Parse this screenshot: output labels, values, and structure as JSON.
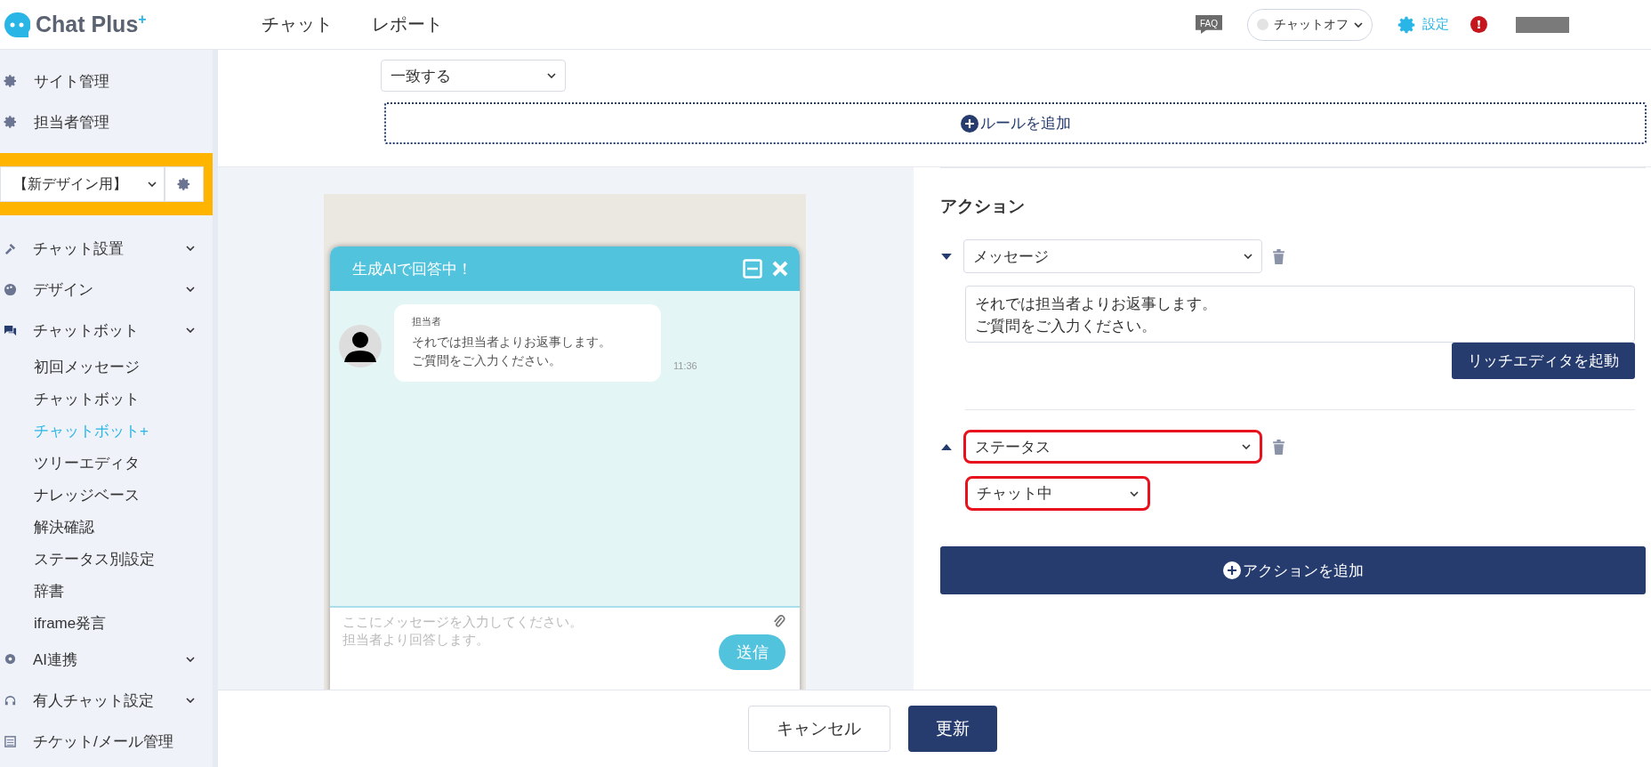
{
  "header": {
    "logo": "Chat Plus",
    "logo_mark": "+",
    "nav": [
      {
        "label": "チャット",
        "selected": false
      },
      {
        "label": "レポート",
        "selected": false
      }
    ],
    "faq_label": "FAQ",
    "chat_status": {
      "label": "チャットオフ",
      "on": false
    },
    "settings_label": "設定"
  },
  "sidebar": {
    "top_items": [
      {
        "label": "サイト管理"
      },
      {
        "label": "担当者管理"
      }
    ],
    "site_select": {
      "value": "【新デザイン用】"
    },
    "menu": [
      {
        "label": "チャット設置"
      },
      {
        "label": "デザイン"
      },
      {
        "label": "チャットボット",
        "children": [
          {
            "label": "初回メッセージ",
            "selected": false
          },
          {
            "label": "チャットボット",
            "selected": false
          },
          {
            "label": "チャットボット+",
            "selected": true
          },
          {
            "label": "ツリーエディタ",
            "selected": false
          },
          {
            "label": "ナレッジベース",
            "selected": false
          },
          {
            "label": "解決確認",
            "selected": false
          },
          {
            "label": "ステータス別設定",
            "selected": false
          },
          {
            "label": "辞書",
            "selected": false
          },
          {
            "label": "iframe発言",
            "selected": false
          }
        ]
      },
      {
        "label": "AI連携"
      },
      {
        "label": "有人チャット設定"
      },
      {
        "label": "チケット/メール管理",
        "kind": "link"
      }
    ]
  },
  "rules": {
    "match_select": "一致する",
    "add_rule": "ルールを追加"
  },
  "preview": {
    "title": "生成AIで回答中！",
    "message": {
      "sender": "担当者",
      "lines": [
        "それでは担当者よりお返事します。",
        "ご質問をご入力ください。"
      ],
      "time": "11:36"
    },
    "input_placeholder_lines": [
      "ここにメッセージを入力してください。",
      "担当者より回答します。"
    ],
    "send": "送信"
  },
  "actions": {
    "heading": "アクション",
    "items": [
      {
        "kind": "message",
        "type_value": "メッセージ",
        "expanded": true,
        "highlighted": false,
        "lines": [
          "それでは担当者よりお返事します。",
          "ご質問をご入力ください。"
        ],
        "rich_editor": "リッチエディタを起動"
      },
      {
        "kind": "status",
        "type_value": "ステータス",
        "expanded": false,
        "highlighted": true,
        "status_value": "チャット中",
        "status_highlighted": true
      }
    ],
    "add_action": "アクションを追加"
  },
  "footer": {
    "cancel": "キャンセル",
    "update": "更新"
  }
}
